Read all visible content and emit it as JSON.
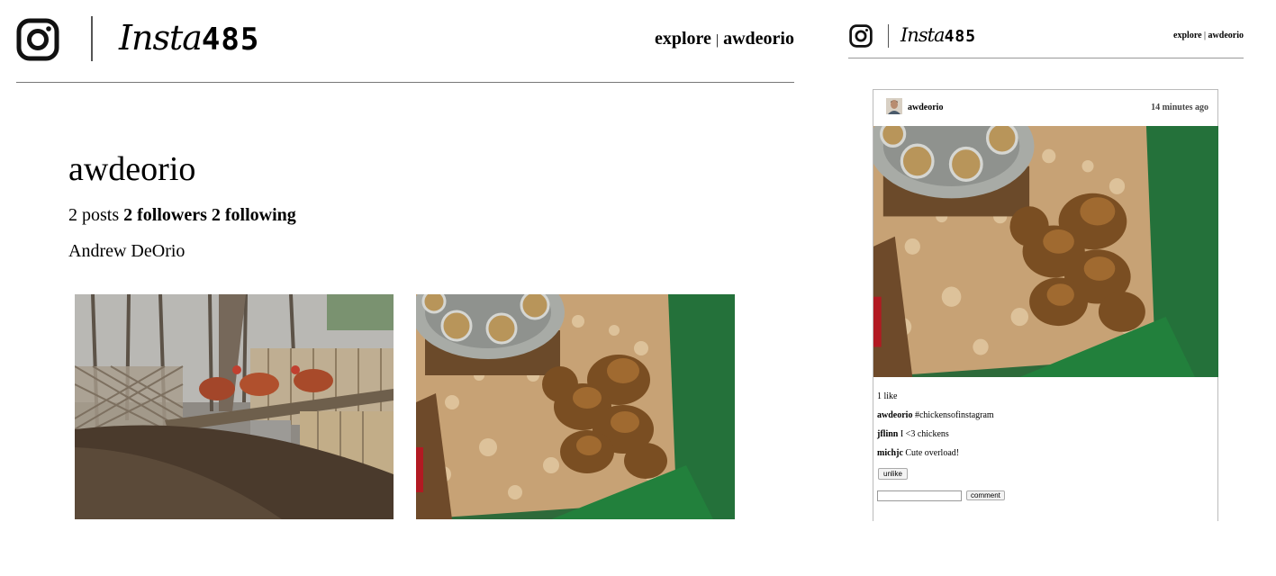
{
  "left_page": {
    "brand": {
      "script": "Insta",
      "number": "485"
    },
    "nav": {
      "explore": "explore",
      "separator": "|",
      "user": "awdeorio"
    },
    "profile": {
      "username": "awdeorio",
      "posts_text": "2 posts",
      "followers_text": "2 followers",
      "following_text": "2 following",
      "fullname": "Andrew DeOrio"
    },
    "thumbnails": [
      {
        "name": "chickens-in-yard"
      },
      {
        "name": "chicks-in-bedding"
      }
    ]
  },
  "right_page": {
    "brand": {
      "script": "Insta",
      "number": "485"
    },
    "nav": {
      "explore": "explore",
      "separator": "|",
      "user": "awdeorio"
    },
    "post": {
      "owner": "awdeorio",
      "timestamp": "14 minutes ago",
      "likes_text": "1 like",
      "comments": [
        {
          "user": "awdeorio",
          "text": "#chickensofinstagram"
        },
        {
          "user": "jflinn",
          "text": "I <3 chickens"
        },
        {
          "user": "michjc",
          "text": "Cute overload!"
        }
      ],
      "unlike_label": "unlike",
      "comment_button_label": "comment",
      "comment_input_value": ""
    }
  },
  "icons": [
    "instagram-camera-icon"
  ]
}
